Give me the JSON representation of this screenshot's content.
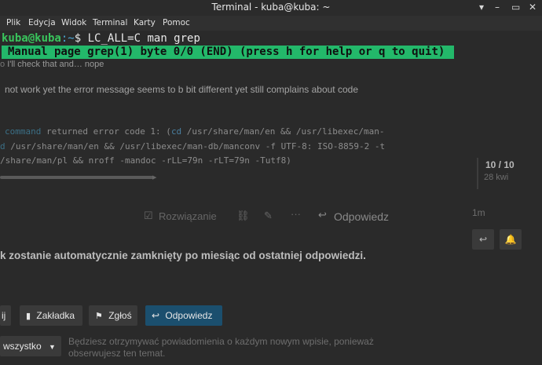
{
  "window": {
    "title": "Terminal - kuba@kuba: ~",
    "controls": [
      "▾",
      "–",
      "▭",
      "✕"
    ]
  },
  "menu": [
    "Plik",
    "Edycja",
    "Widok",
    "Terminal",
    "Karty",
    "Pomoc"
  ],
  "terminal": {
    "prompt_user": "kuba@kuba",
    "prompt_sep": ":",
    "prompt_path": "~",
    "prompt_symbol": "$",
    "command": "LC_ALL=C man grep",
    "status_line": "Manual page grep(1) byte 0/0 (END) (press h for help or q to quit)"
  },
  "background_page": {
    "line1": "I'll check that and… nope",
    "line2": "not work yet the error message seems to b bit different yet still complains about code",
    "code1_kw": "command",
    "code1_rest": " returned error code 1: (",
    "code1_cd": "cd",
    "code1_tail": " /usr/share/man/en && /usr/libexec/man-",
    "code2_kw": "d",
    "code2_rest": " /usr/share/man/en && /usr/libexec/man-db/manconv -f UTF-8: ISO-8859-2 -t",
    "code3": "/share/man/pl && nroff -mandoc -rLL=79n -rLT=79n -Tutf8)",
    "progress": "10 / 10",
    "progress_sub": "28 kwi",
    "reply_time": "1m",
    "solution_label": "Rozwiązanie",
    "reply_label": "Odpowiedz",
    "closing_notice": "k zostanie automatycznie zamknięty po miesiąc od ostatniej odpowiedzi.",
    "btn_partial": "ij",
    "bookmark_label": "Zakładka",
    "flag_label": "Zgłoś",
    "reply_button": "Odpowiedz",
    "watch_select": "wszystko",
    "notify_text1": "Będziesz otrzymywać powiadomienia o każdym nowym wpisie, ponieważ",
    "notify_text2": "obserwujesz ten temat."
  }
}
